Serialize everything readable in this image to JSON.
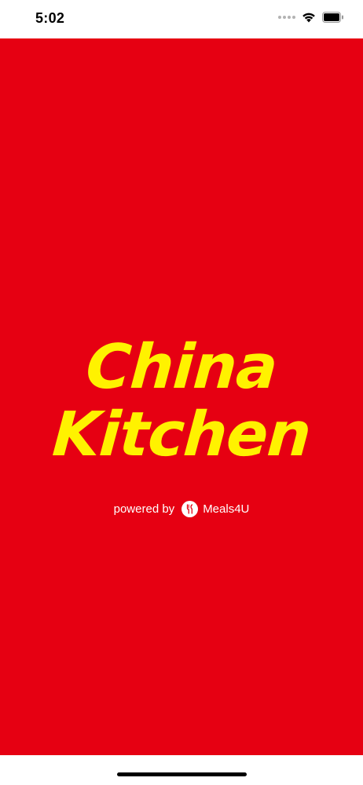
{
  "status_bar": {
    "time": "5:02",
    "wifi_icon": "wifi-icon",
    "battery_icon": "battery-icon"
  },
  "splash": {
    "background_color": "#e60012",
    "brand_color": "#fff200",
    "title_line1": "China",
    "title_line2": "Kitchen",
    "powered_by_label": "powered by",
    "provider_name": "Meals4U",
    "provider_logo_icon": "meals4u-logo-icon"
  }
}
